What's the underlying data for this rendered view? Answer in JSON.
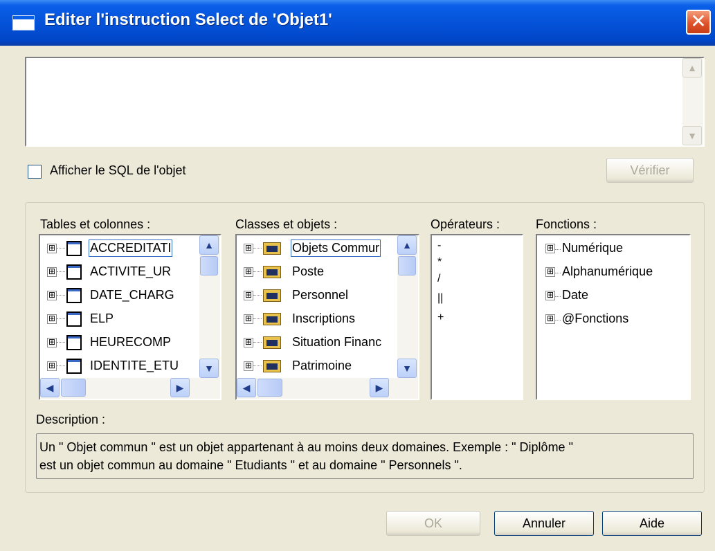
{
  "window": {
    "title": "Editer l'instruction Select de 'Objet1'",
    "close_glyph": "✕"
  },
  "sql_editor": {
    "value": ""
  },
  "show_sql_checkbox": {
    "label": "Afficher le SQL de l'objet",
    "checked": false
  },
  "verify_button": {
    "label": "Vérifier",
    "enabled": false
  },
  "tables": {
    "label": "Tables et colonnes :",
    "items": [
      {
        "label": "ACCREDITATI",
        "selected": true
      },
      {
        "label": "ACTIVITE_UR"
      },
      {
        "label": "DATE_CHARG"
      },
      {
        "label": "ELP"
      },
      {
        "label": "HEURECOMP"
      },
      {
        "label": "IDENTITE_ETU"
      }
    ]
  },
  "classes": {
    "label": "Classes et objets :",
    "items": [
      {
        "label": "Objets Commur",
        "selected": true
      },
      {
        "label": "Poste"
      },
      {
        "label": "Personnel"
      },
      {
        "label": "Inscriptions"
      },
      {
        "label": "Situation Financ"
      },
      {
        "label": "Patrimoine"
      }
    ]
  },
  "operators": {
    "label": "Opérateurs :",
    "items": [
      "-",
      "*",
      "/",
      "||",
      "+"
    ]
  },
  "functions": {
    "label": "Fonctions :",
    "items": [
      "Numérique",
      "Alphanumérique",
      "Date",
      "@Fonctions"
    ]
  },
  "description": {
    "label": "Description :",
    "line1": "Un \" Objet commun \" est un objet appartenant à au moins deux domaines. Exemple : \" Diplôme \"",
    "line2": "est un objet commun au domaine \" Etudiants \" et au domaine \" Personnels \"."
  },
  "buttons": {
    "ok": "OK",
    "cancel": "Annuler",
    "help": "Aide"
  },
  "icons": {
    "expand": "⊞",
    "scroll_up": "▲",
    "scroll_down": "▼",
    "scroll_left": "◀",
    "scroll_right": "▶"
  },
  "colors": {
    "titlebar": "#0553d8",
    "face": "#ece9d8",
    "selection": "#316ac5"
  }
}
